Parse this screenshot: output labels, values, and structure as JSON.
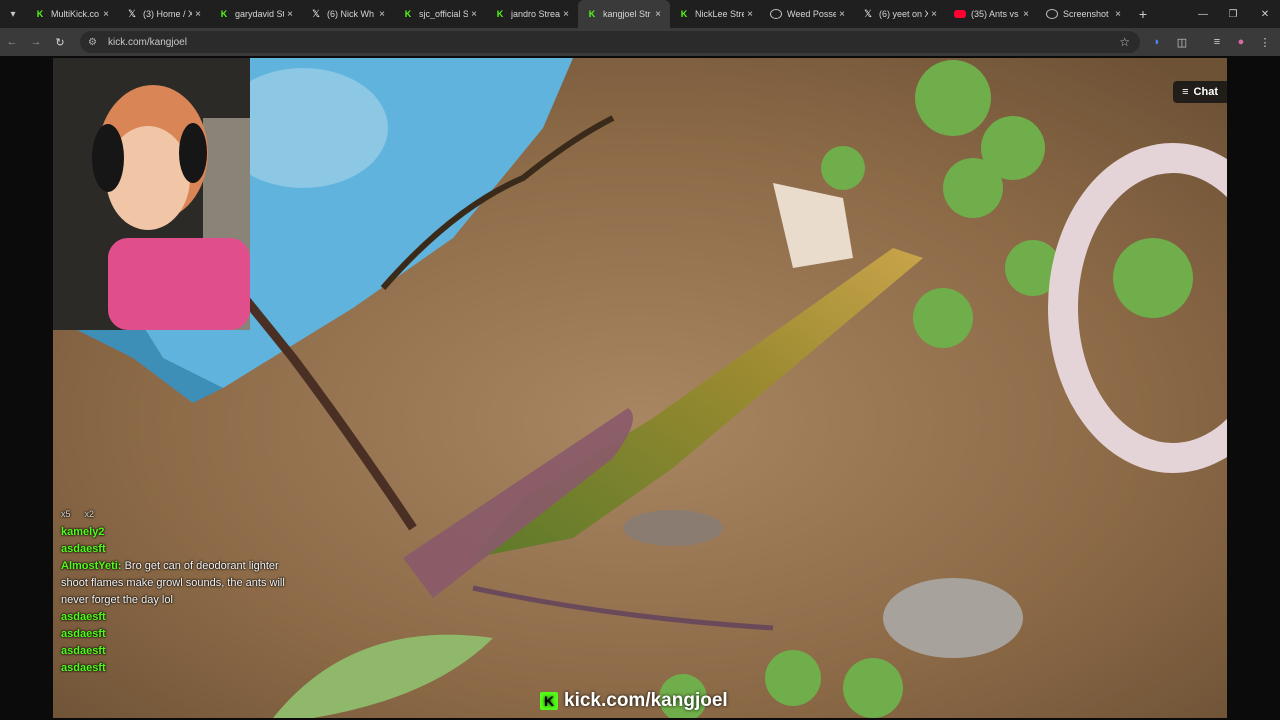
{
  "browser": {
    "tabs": [
      {
        "title": "MultiKick.co",
        "icon": "kick",
        "active": false
      },
      {
        "title": "(3) Home / X",
        "icon": "x",
        "active": false
      },
      {
        "title": "garydavid St",
        "icon": "kick",
        "active": false
      },
      {
        "title": "(6) Nick Wh",
        "icon": "x",
        "active": false
      },
      {
        "title": "sjc_official S",
        "icon": "kick",
        "active": false
      },
      {
        "title": "jandro Strea",
        "icon": "kick",
        "active": false
      },
      {
        "title": "kangjoel Str",
        "icon": "kick",
        "active": true
      },
      {
        "title": "NickLee Stre",
        "icon": "kick",
        "active": false
      },
      {
        "title": "Weed Posse",
        "icon": "globe",
        "active": false
      },
      {
        "title": "(6) yeet on X",
        "icon": "x",
        "active": false
      },
      {
        "title": "(35) Ants vs",
        "icon": "youtube",
        "active": false
      },
      {
        "title": "Screenshot",
        "icon": "globe",
        "active": false
      }
    ],
    "url": "kick.com/kangjoel",
    "new_tab": "+",
    "tab_close": "×"
  },
  "stream": {
    "chat_button": "Chat",
    "watermark": "kick.com/kangjoel",
    "watermark_logo": "K"
  },
  "overlay_chat": {
    "badges": [
      "x5",
      "x2"
    ],
    "lines": [
      {
        "user": "kamely2",
        "text": ""
      },
      {
        "user": "asdaesft",
        "text": ""
      },
      {
        "user": "AlmostYeti:",
        "text": "Bro get can of deodorant lighter shoot flames make growl sounds, the ants will never forget the day lol"
      },
      {
        "user": "asdaesft",
        "text": ""
      },
      {
        "user": "asdaesft",
        "text": ""
      },
      {
        "user": "asdaesft",
        "text": ""
      },
      {
        "user": "asdaesft",
        "text": ""
      }
    ]
  },
  "colors": {
    "kick_green": "#53fc18",
    "tab_bg": "#1f1f1f",
    "active_tab": "#3a3a3a"
  }
}
